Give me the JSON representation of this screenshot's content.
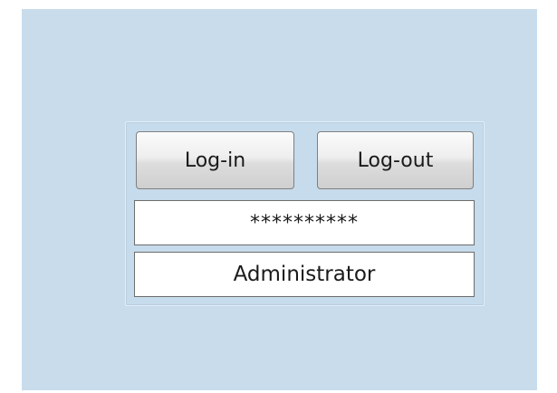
{
  "login_panel": {
    "login_button_label": "Log-in",
    "logout_button_label": "Log-out",
    "password_value": "**********",
    "user_value": "Administrator"
  },
  "colors": {
    "background": "#c8dcec",
    "field_background": "#ffffff",
    "button_gradient_top": "#fbfbfb",
    "button_gradient_bottom": "#cfcfcf"
  }
}
